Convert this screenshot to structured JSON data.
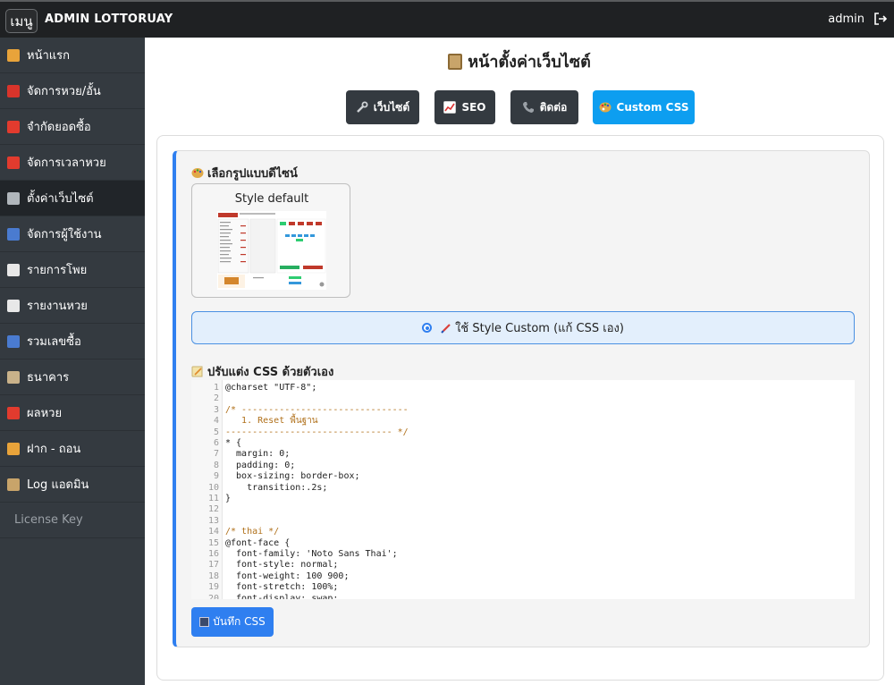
{
  "topbar": {
    "menu_label": "เมนู",
    "brand": "ADMIN LOTTORUAY",
    "user": "admin"
  },
  "sidebar": {
    "items": [
      {
        "label": "หน้าแรก",
        "icon": "home-icon",
        "color": "#e8a33a"
      },
      {
        "label": "จัดการหวย/อั้น",
        "icon": "calendar-icon",
        "color": "#d9342b"
      },
      {
        "label": "จำกัดยอดซื้อ",
        "icon": "no-entry-icon",
        "color": "#e23b2e"
      },
      {
        "label": "จัดการเวลาหวย",
        "icon": "alarm-clock-icon",
        "color": "#e23b2e"
      },
      {
        "label": "ตั้งค่าเว็บไซต์",
        "icon": "gear-icon",
        "color": "#b0b6bb"
      },
      {
        "label": "จัดการผู้ใช้งาน",
        "icon": "user-icon",
        "color": "#4a7bd0"
      },
      {
        "label": "รายการโพย",
        "icon": "document-icon",
        "color": "#e8e8e8"
      },
      {
        "label": "รายงานหวย",
        "icon": "chart-icon",
        "color": "#e8e8e8"
      },
      {
        "label": "รวมเลขซื้อ",
        "icon": "numbers-icon",
        "color": "#4a7bd0"
      },
      {
        "label": "ธนาคาร",
        "icon": "bank-icon",
        "color": "#c9b28a"
      },
      {
        "label": "ผลหวย",
        "icon": "target-icon",
        "color": "#e23b2e"
      },
      {
        "label": "ฝาก - ถอน",
        "icon": "money-bag-icon",
        "color": "#e8a33a"
      },
      {
        "label": "Log แอดมิน",
        "icon": "clipboard-icon",
        "color": "#c8a46a"
      }
    ],
    "license": "License Key",
    "active_index": 4
  },
  "page": {
    "title": "หน้าตั้งค่าเว็บไซต์"
  },
  "tabs": [
    {
      "label": "เว็บไซต์",
      "icon": "wrench-icon"
    },
    {
      "label": "SEO",
      "icon": "chart-icon"
    },
    {
      "label": "ติดต่อ",
      "icon": "phone-icon"
    },
    {
      "label": "Custom CSS",
      "icon": "palette-icon"
    }
  ],
  "design": {
    "section_title": "เลือกรูปแบบดีไซน์",
    "style_default_label": "Style default",
    "custom_option_label": "ใช้ Style Custom (แก้ CSS เอง)",
    "custom_selected": true
  },
  "css_editor": {
    "section_title": "ปรับแต่ง CSS ด้วยตัวเอง",
    "lines": [
      "@charset \"UTF-8\";",
      "",
      "/* -------------------------------",
      "   1. Reset พื้นฐาน",
      "------------------------------- */",
      "* {",
      "  margin: 0;",
      "  padding: 0;",
      "  box-sizing: border-box;",
      "    transition:.2s;",
      "}",
      "",
      "",
      "/* thai */",
      "@font-face {",
      "  font-family: 'Noto Sans Thai';",
      "  font-style: normal;",
      "  font-weight: 100 900;",
      "  font-stretch: 100%;",
      "  font-display: swap;"
    ],
    "save_label": "บันทึก CSS"
  },
  "colors": {
    "accent": "#2f7ff0",
    "tab_active": "#0d9ef0",
    "tab_default": "#343a40",
    "sidebar_bg": "#343a40",
    "topbar_bg": "#1f2123"
  }
}
